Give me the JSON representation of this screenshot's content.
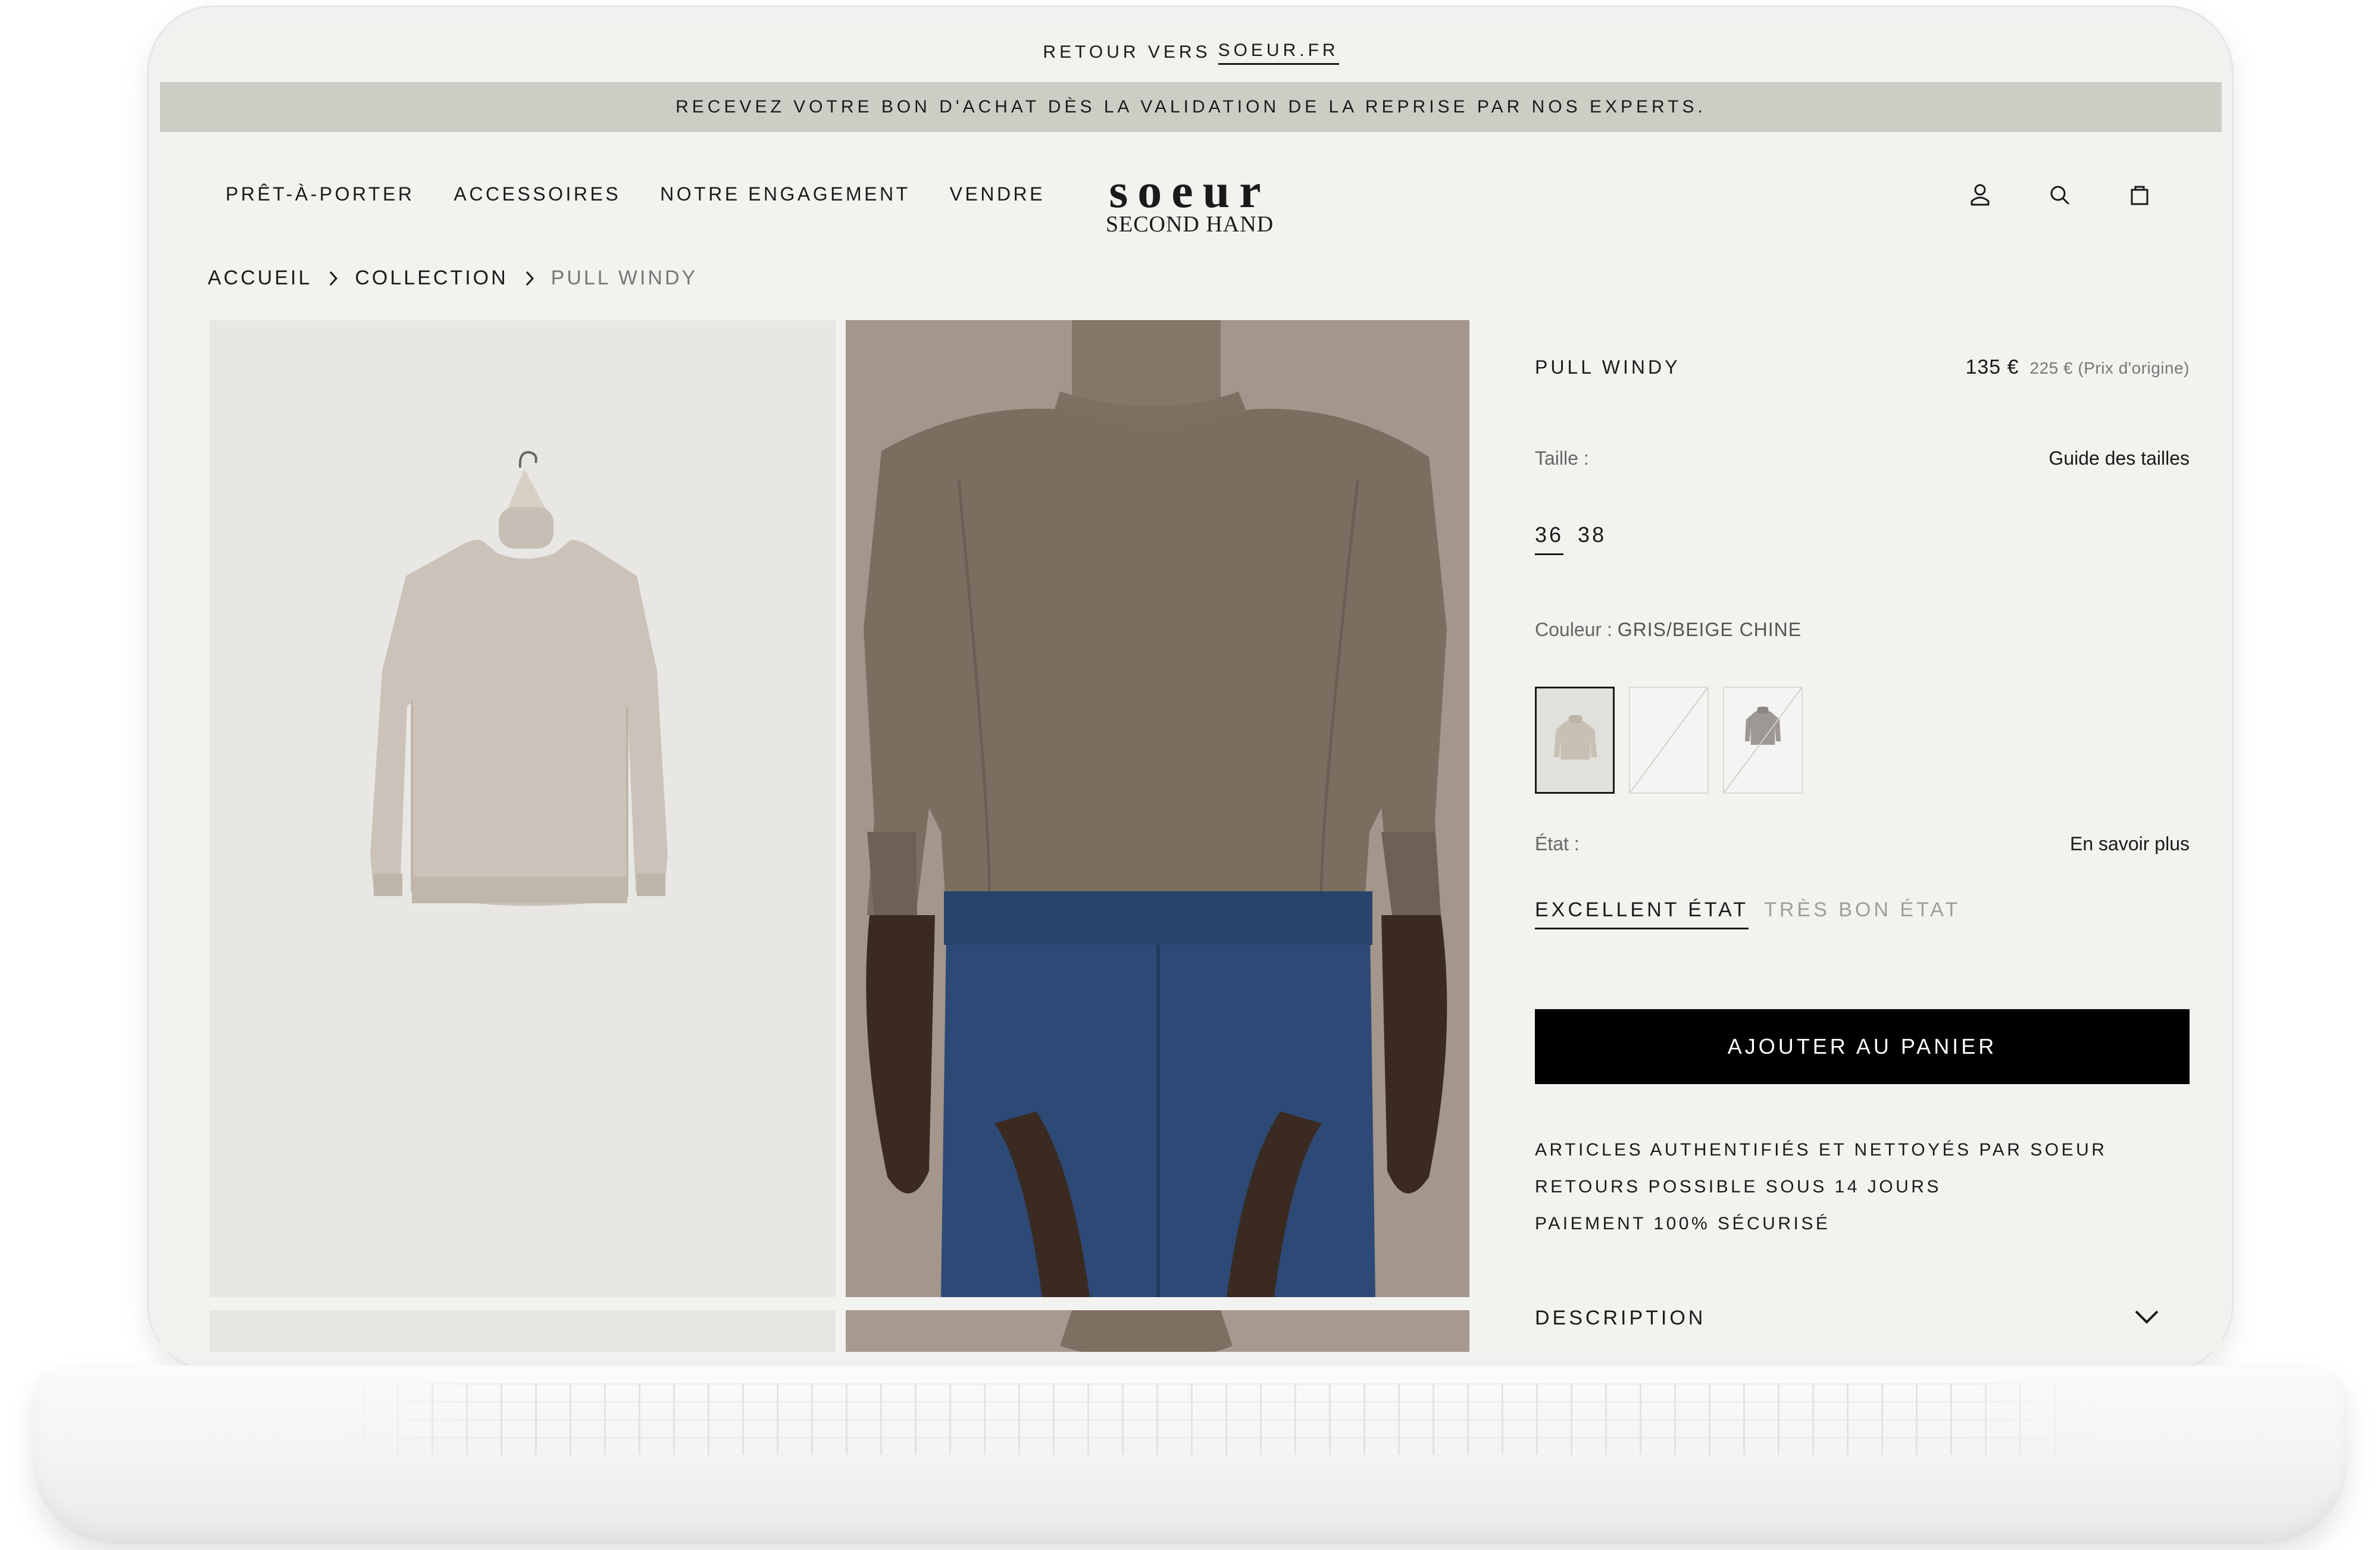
{
  "top_bar": {
    "text": "RETOUR VERS",
    "link": "SOEUR.FR"
  },
  "promo_bar": {
    "text": "RECEVEZ VOTRE BON D'ACHAT DÈS LA VALIDATION DE LA REPRISE PAR NOS EXPERTS."
  },
  "nav": {
    "links": [
      "PRÊT-À-PORTER",
      "ACCESSOIRES",
      "NOTRE ENGAGEMENT",
      "VENDRE"
    ],
    "logo_line1": "soeur",
    "logo_line2": "SECOND HAND",
    "icons": [
      "account-icon",
      "search-icon",
      "bag-icon"
    ]
  },
  "breadcrumb": {
    "home": "ACCUEIL",
    "collection": "COLLECTION",
    "current": "PULL WINDY"
  },
  "product": {
    "name": "PULL WINDY",
    "price": "135 €",
    "original_price": "225 € (Prix d'origine)",
    "size_label": "Taille :",
    "size_guide": "Guide des tailles",
    "sizes": [
      "36",
      "38"
    ],
    "selected_size": "36",
    "color_label": "Couleur :",
    "color_value": "GRIS/BEIGE CHINE",
    "condition_label": "État :",
    "condition_link": "En savoir plus",
    "conditions": [
      "EXCELLENT ÉTAT",
      "TRÈS BON ÉTAT"
    ],
    "selected_condition": "EXCELLENT ÉTAT",
    "add_to_cart": "AJOUTER AU PANIER",
    "assurances": [
      "ARTICLES AUTHENTIFIÉS ET NETTOYÉS PAR SOEUR",
      "RETOURS POSSIBLE SOUS 14 JOURS",
      "PAIEMENT 100% SÉCURISÉ"
    ],
    "description_label": "DESCRIPTION"
  },
  "colors": {
    "background": "#f2f2ef",
    "promo_bar": "#cdcdc5",
    "button": "#000000",
    "muted_text": "#9e9e9a"
  }
}
